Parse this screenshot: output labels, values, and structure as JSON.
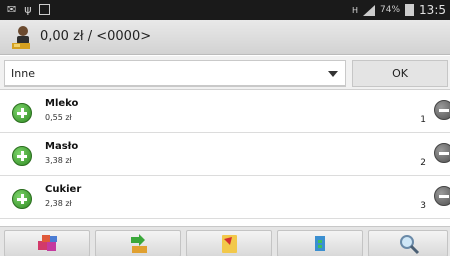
{
  "status_bar": {
    "icons": [
      "mail-icon",
      "usb-icon",
      "image-icon",
      "hplus-icon",
      "signal-icon"
    ],
    "battery": "74%",
    "time": "13:5"
  },
  "header": {
    "title": "0,00 zł / <0000>"
  },
  "filter": {
    "category": "Inne",
    "ok_label": "OK"
  },
  "products": [
    {
      "name": "Mleko",
      "price": "0,55 zł",
      "quantity": "1"
    },
    {
      "name": "Masło",
      "price": "3,38 zł",
      "quantity": "2"
    },
    {
      "name": "Cukier",
      "price": "2,38 zł",
      "quantity": "3"
    }
  ],
  "bottom_buttons": [
    "cubes-icon",
    "transfer-icon",
    "document-icon",
    "scanner-icon",
    "search-icon"
  ],
  "colors": {
    "accent_plus": "#3f9b2f",
    "minus": "#5a5a5a",
    "status_bar": "#1a1a1a"
  }
}
